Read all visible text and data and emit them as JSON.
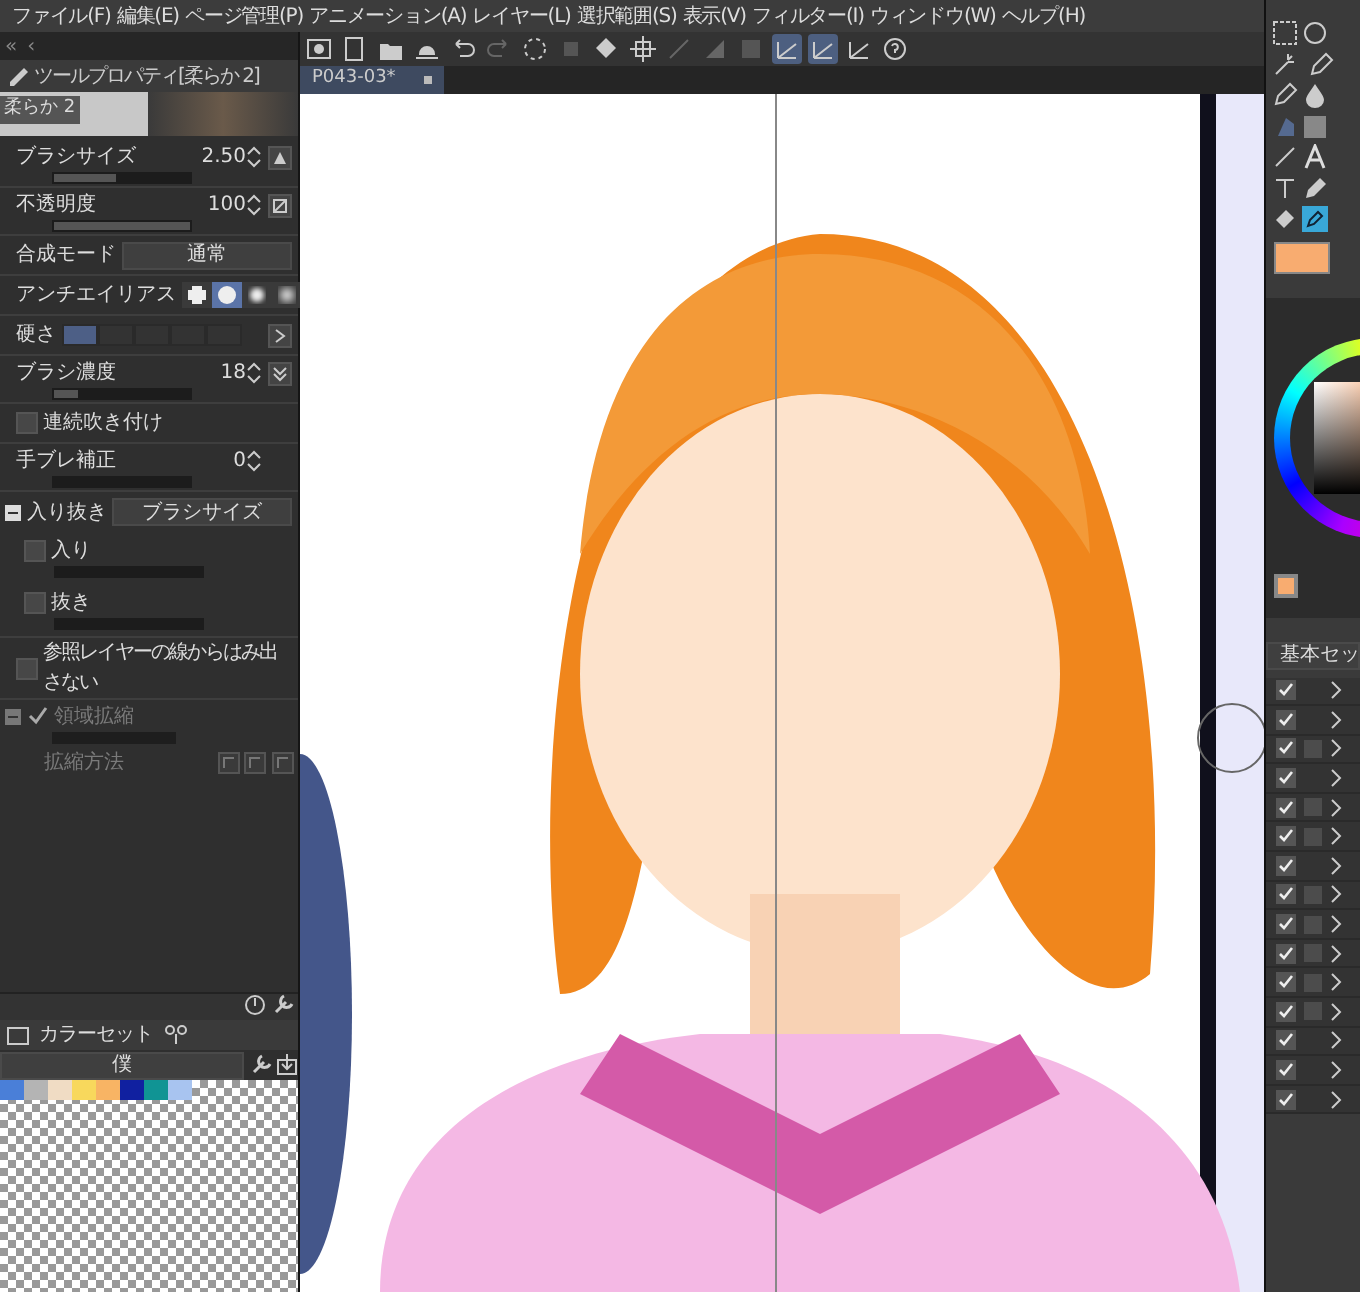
{
  "menu": [
    "ファイル(F)",
    "編集(E)",
    "ページ管理(P)",
    "アニメーション(A)",
    "レイヤー(L)",
    "選択範囲(S)",
    "表示(V)",
    "フィルター(I)",
    "ウィンドウ(W)",
    "ヘルプ(H)"
  ],
  "panel_nav": [
    "«",
    "‹"
  ],
  "snap_buttons": [
    {
      "selected": true
    },
    {
      "selected": true
    },
    {
      "selected": false
    }
  ],
  "document_tab": {
    "title": "P043-03*"
  },
  "tool_property": {
    "title": "ツールプロパティ[柔らか 2]",
    "preset": "柔らか 2",
    "brush_size": {
      "label": "ブラシサイズ",
      "value": "2.50",
      "level": 0.45
    },
    "opacity": {
      "label": "不透明度",
      "value": "100",
      "level": 1
    },
    "blend_mode": {
      "label": "合成モード",
      "value": "通常"
    },
    "antialias": {
      "label": "アンチエイリアス",
      "options": [
        {
          "selected": false
        },
        {
          "selected": true
        },
        {
          "selected": false
        },
        {
          "selected": false
        }
      ]
    },
    "hardness": {
      "label": "硬さ",
      "steps": [
        {
          "selected": true
        },
        {
          "selected": false
        },
        {
          "selected": false
        },
        {
          "selected": false
        },
        {
          "selected": false
        }
      ]
    },
    "brush_density": {
      "label": "ブラシ濃度",
      "value": "18",
      "level": 0.18
    },
    "continuous_spray": {
      "label": "連続吹き付け",
      "checked": false
    },
    "stabilization": {
      "label": "手ブレ補正",
      "value": "0"
    },
    "taper": {
      "label": "入り抜き",
      "value": "ブラシサイズ",
      "expanded": true,
      "items": [
        {
          "label": "入り",
          "checked": false
        },
        {
          "label": "抜き",
          "checked": false
        }
      ]
    },
    "reference_layer": {
      "label": "参照レイヤーの線からはみ出さない",
      "checked": false
    },
    "area_scaling": {
      "label": "領域拡縮",
      "checked": true,
      "disabled": true,
      "method_label": "拡縮方法"
    }
  },
  "color_set": {
    "tab": "カラーセット",
    "set_name": "僕",
    "swatches": [
      {
        "color": "#4a7fd8"
      },
      {
        "color": "#b4b4b4"
      },
      {
        "color": "#f0dcc4"
      },
      {
        "color": "#f8d85c"
      },
      {
        "color": "#f8b464"
      },
      {
        "color": "#1020a0"
      },
      {
        "color": "#109494"
      },
      {
        "color": "#a8c4f0"
      }
    ]
  },
  "layer_panel": {
    "set_button": "基本セッ",
    "rows": [
      {
        "visible": true,
        "flagged": false
      },
      {
        "visible": true,
        "flagged": false
      },
      {
        "visible": true,
        "flagged": true
      },
      {
        "visible": true,
        "flagged": false
      },
      {
        "visible": true,
        "flagged": true
      },
      {
        "visible": true,
        "flagged": true
      },
      {
        "visible": true,
        "flagged": false
      },
      {
        "visible": true,
        "flagged": true
      },
      {
        "visible": true,
        "flagged": true
      },
      {
        "visible": true,
        "flagged": true
      },
      {
        "visible": true,
        "flagged": true
      },
      {
        "visible": true,
        "flagged": true
      },
      {
        "visible": true,
        "flagged": false
      },
      {
        "visible": true,
        "flagged": false
      },
      {
        "visible": true,
        "flagged": false
      }
    ]
  }
}
